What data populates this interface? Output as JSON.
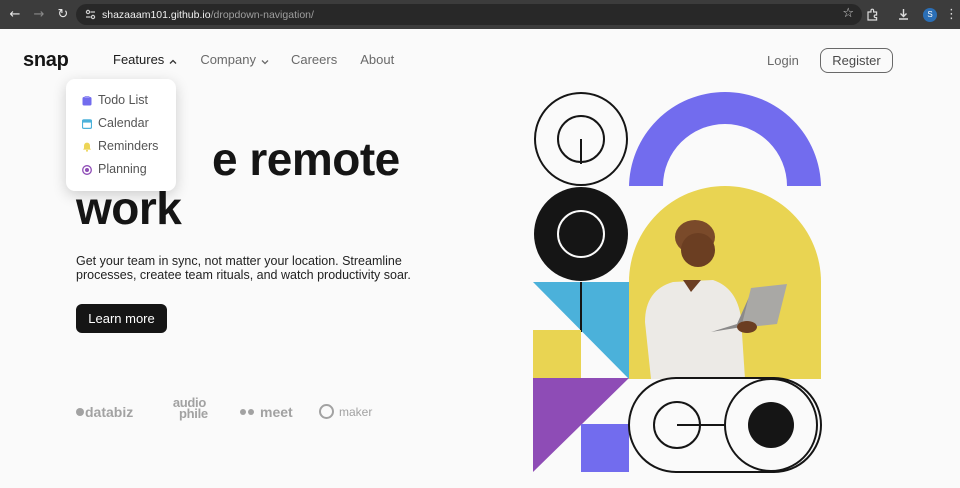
{
  "browser": {
    "url_host": "shazaaam101.github.io",
    "url_path": "/dropdown-navigation/",
    "profile_initial": "S"
  },
  "header": {
    "logo": "snap",
    "nav": [
      {
        "label": "Features",
        "open": true
      },
      {
        "label": "Company",
        "open": false
      },
      {
        "label": "Careers"
      },
      {
        "label": "About"
      }
    ],
    "login": "Login",
    "register": "Register"
  },
  "dropdown": {
    "items": [
      {
        "label": "Todo List",
        "icon": "todo-icon",
        "color": "#726CEE"
      },
      {
        "label": "Calendar",
        "icon": "calendar-icon",
        "color": "#4BB1DA"
      },
      {
        "label": "Reminders",
        "icon": "bell-icon",
        "color": "#EDD556"
      },
      {
        "label": "Planning",
        "icon": "planning-icon",
        "color": "#8E4CB6"
      }
    ]
  },
  "hero": {
    "title_line1": "e remote",
    "title_line2": "work",
    "text": "Get your team in sync, not matter your location. Streamline processes, createe team rituals, and watch productivity soar.",
    "cta": "Learn more"
  },
  "clients": {
    "databiz": "databiz",
    "audiophile_top": "audio",
    "audiophile_bottom": "phile",
    "meet": "meet",
    "maker": "maker"
  },
  "colors": {
    "purple": "#726CEE",
    "blue": "#4BB1DA",
    "yellow": "#E9D452",
    "violet": "#8E4CB6",
    "ink": "#151515"
  }
}
